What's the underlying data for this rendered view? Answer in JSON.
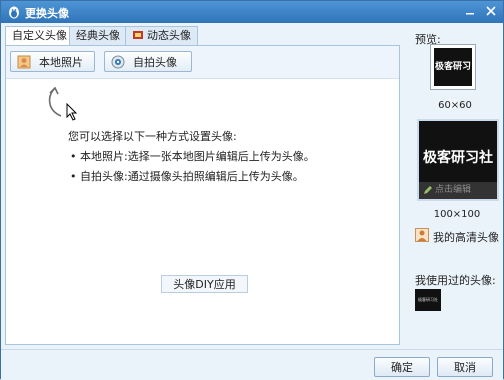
{
  "window": {
    "title": "更换头像"
  },
  "tabs": [
    {
      "label": "自定义头像",
      "active": true
    },
    {
      "label": "经典头像",
      "active": false
    },
    {
      "label": "动态头像",
      "active": false
    }
  ],
  "toolbar": {
    "local_photo_label": "本地照片",
    "selfie_label": "自拍头像"
  },
  "instructions": {
    "intro": "您可以选择以下一种方式设置头像:",
    "items": [
      "本地照片:选择一张本地图片编辑后上传为头像。",
      "自拍头像:通过摄像头拍照编辑后上传为头像。"
    ]
  },
  "diy_button_label": "头像DIY应用",
  "preview": {
    "label": "预览:",
    "avatar_text": "极客研习社",
    "small_size": "60×60",
    "large_size": "100×100",
    "edit_label": "点击编辑",
    "hd_avatar_label": "我的高清头像"
  },
  "used_avatars": {
    "label": "我使用过的头像:",
    "thumb_text": "极客研习社"
  },
  "buttons": {
    "ok": "确定",
    "cancel": "取消"
  },
  "icons": {
    "app": "penguin-icon",
    "local_photo": "photo-icon",
    "selfie": "camera-icon",
    "dynamic": "film-icon",
    "edit": "pencil-icon",
    "hd": "user-icon"
  },
  "colors": {
    "titlebar": "#2f74b8",
    "accent": "#3a6fa8"
  }
}
